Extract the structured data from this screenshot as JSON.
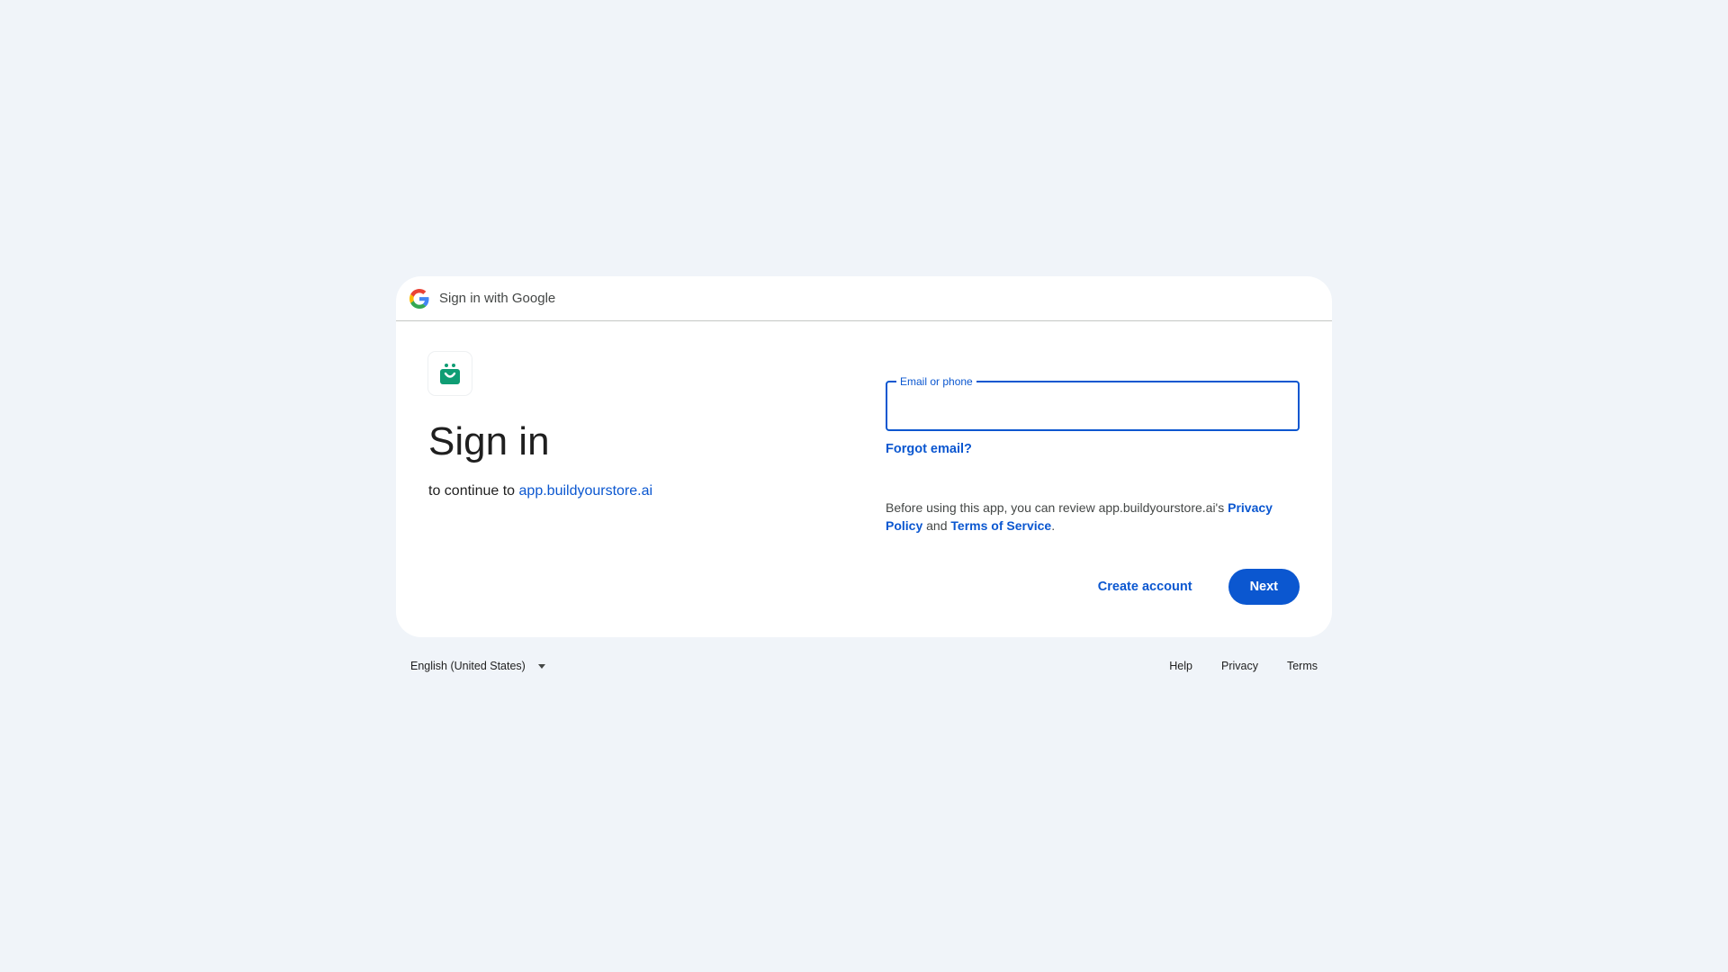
{
  "header": {
    "title": "Sign in with Google",
    "icon": "google-g-icon"
  },
  "app": {
    "icon": "shopping-bag-smile-icon",
    "icon_color": "#0f9d74"
  },
  "main": {
    "title": "Sign in",
    "subtitle_prefix": "to continue to",
    "app_link": "app.buildyourstore.ai"
  },
  "form": {
    "email_label": "Email or phone",
    "email_value": "",
    "forgot_email": "Forgot email?",
    "policy_prefix": "Before using this app, you can review app.buildyourstore.ai's",
    "privacy_policy": "Privacy Policy",
    "policy_and": "and",
    "terms_of_service": "Terms of Service",
    "policy_suffix": "."
  },
  "actions": {
    "create_account": "Create account",
    "next": "Next"
  },
  "footer": {
    "language": "English (United States)",
    "help": "Help",
    "privacy": "Privacy",
    "terms": "Terms"
  },
  "colors": {
    "accent": "#0b57d0",
    "background": "#f0f4f9",
    "card": "#ffffff"
  }
}
